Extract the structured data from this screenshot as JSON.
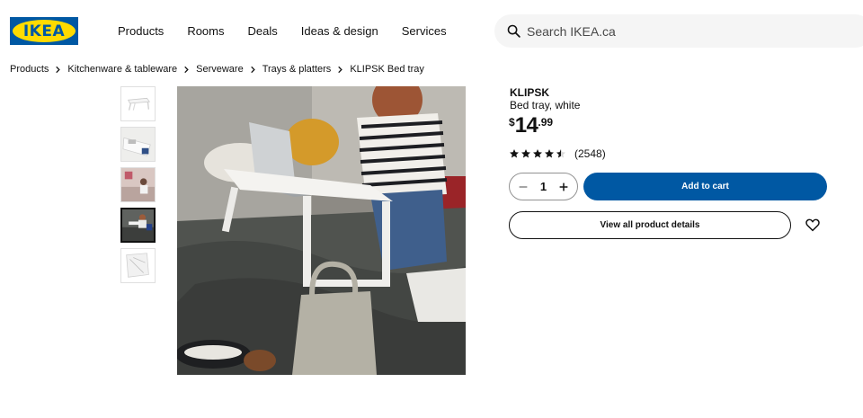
{
  "header": {
    "logo_text": "IKEA",
    "nav": [
      "Products",
      "Rooms",
      "Deals",
      "Ideas & design",
      "Services"
    ],
    "search_placeholder": "Search IKEA.ca"
  },
  "breadcrumb": [
    "Products",
    "Kitchenware & tableware",
    "Serveware",
    "Trays & platters",
    "KLIPSK Bed tray"
  ],
  "product": {
    "name": "KLIPSK",
    "description": "Bed tray, white",
    "price_currency": "$",
    "price_integer": "14",
    "price_decimal": ".99",
    "rating": 4.5,
    "review_count": "(2548)",
    "quantity": "1",
    "add_to_cart_label": "Add to cart",
    "details_label": "View all product details"
  },
  "gallery": {
    "thumbnail_count": 5,
    "selected_thumbnail": 4
  },
  "icons": {
    "search": "search-icon",
    "chevron": "chevron-right-icon",
    "star": "star-icon",
    "minus": "minus-icon",
    "plus": "plus-icon",
    "heart": "heart-icon"
  },
  "colors": {
    "brand_blue": "#0058a3",
    "brand_yellow": "#ffdb00",
    "text": "#111111"
  }
}
